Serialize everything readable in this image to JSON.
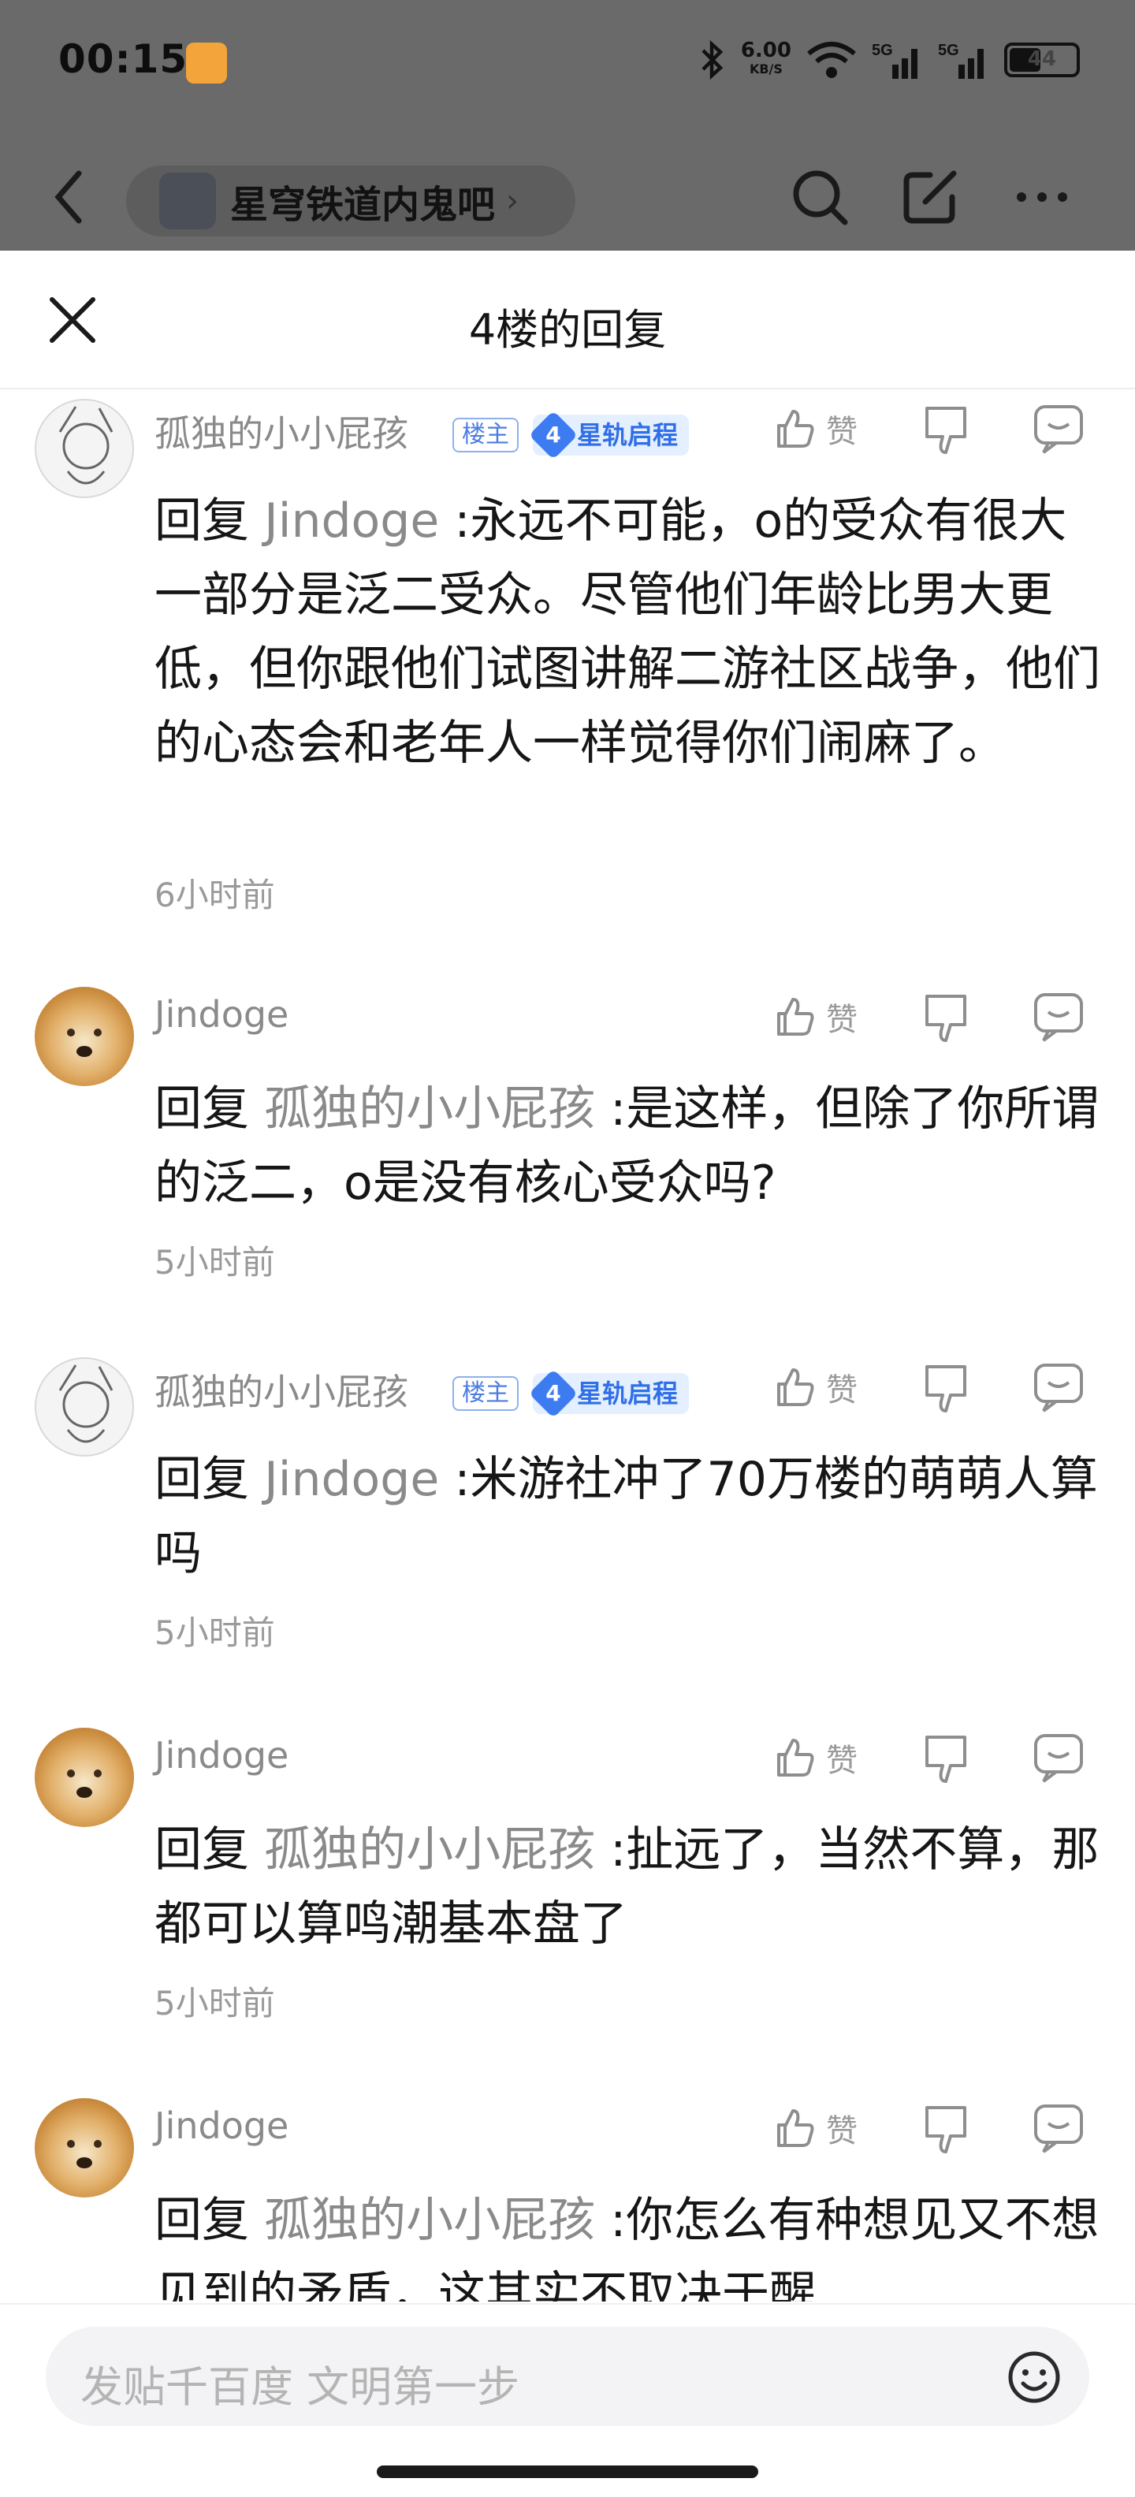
{
  "status_bar": {
    "time": "00:15",
    "net_speed": "6.00",
    "net_unit": "KB/S",
    "battery": "44"
  },
  "nav": {
    "forum_name": "星穹铁道内鬼吧"
  },
  "sheet": {
    "title": "4楼的回复"
  },
  "replies": [
    {
      "user": "孤独的小小屁孩",
      "owner_tag": "楼主",
      "level": "4",
      "level_name": "星轨启程",
      "like_label": "赞",
      "reply_prefix": "回复",
      "mention": "Jindoge",
      "text": ":永远不可能，o的受众有很大一部分是泛二受众。尽管他们年龄比男大更低，但你跟他们试图讲解二游社区战争，他们的心态会和老年人一样觉得你们闹麻了。",
      "time": "6小时前"
    },
    {
      "user": "Jindoge",
      "like_label": "赞",
      "reply_prefix": "回复",
      "mention": "孤独的小小屁孩",
      "text": ":是这样，但除了你所谓的泛二，o是没有核心受众吗?",
      "time": "5小时前"
    },
    {
      "user": "孤独的小小屁孩",
      "owner_tag": "楼主",
      "level": "4",
      "level_name": "星轨启程",
      "like_label": "赞",
      "reply_prefix": "回复",
      "mention": "Jindoge",
      "text": ":米游社冲了70万楼的萌萌人算吗",
      "time": "5小时前"
    },
    {
      "user": "Jindoge",
      "like_label": "赞",
      "reply_prefix": "回复",
      "mention": "孤独的小小屁孩",
      "text": ":扯远了，当然不算，那都可以算鸣潮基本盘了",
      "time": "5小时前"
    },
    {
      "user": "Jindoge",
      "like_label": "赞",
      "reply_prefix": "回复",
      "mention": "孤独的小小屁孩",
      "text": ":你怎么有种想见又不想见到的矛盾，这其实不取决于醒",
      "time": ""
    }
  ],
  "composer": {
    "placeholder": "发贴千百度 文明第一步"
  }
}
